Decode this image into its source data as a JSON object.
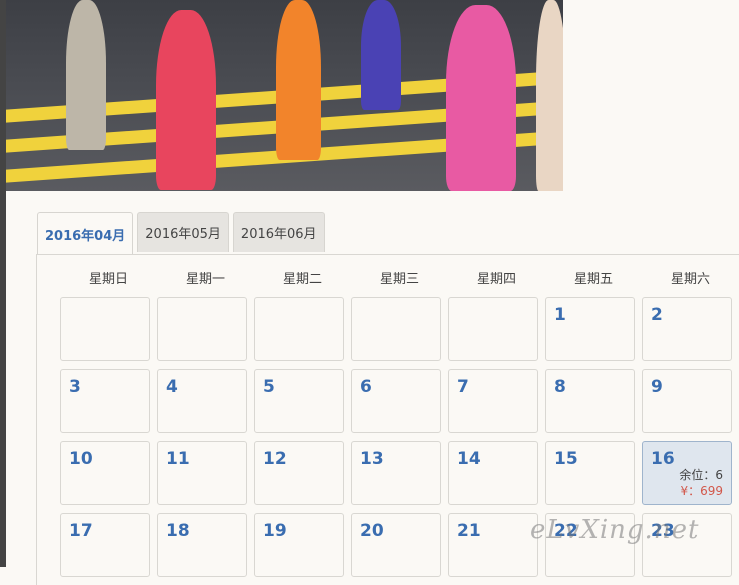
{
  "banner": {
    "carousel": {
      "count": 6,
      "active_index": 2
    }
  },
  "tabs": [
    {
      "label": "2016年04月",
      "active": true
    },
    {
      "label": "2016年05月",
      "active": false
    },
    {
      "label": "2016年06月",
      "active": false
    }
  ],
  "weekdays": [
    "星期日",
    "星期一",
    "星期二",
    "星期三",
    "星期四",
    "星期五",
    "星期六"
  ],
  "calendar": {
    "cells": [
      {
        "day": ""
      },
      {
        "day": ""
      },
      {
        "day": ""
      },
      {
        "day": ""
      },
      {
        "day": ""
      },
      {
        "day": "1"
      },
      {
        "day": "2"
      },
      {
        "day": "3"
      },
      {
        "day": "4"
      },
      {
        "day": "5"
      },
      {
        "day": "6"
      },
      {
        "day": "7"
      },
      {
        "day": "8"
      },
      {
        "day": "9"
      },
      {
        "day": "10"
      },
      {
        "day": "11"
      },
      {
        "day": "12"
      },
      {
        "day": "13"
      },
      {
        "day": "14"
      },
      {
        "day": "15"
      },
      {
        "day": "16",
        "seats": "余位：6",
        "price": "¥：699",
        "highlight": true
      },
      {
        "day": "17"
      },
      {
        "day": "18"
      },
      {
        "day": "19"
      },
      {
        "day": "20"
      },
      {
        "day": "21"
      },
      {
        "day": "22"
      },
      {
        "day": "23"
      }
    ]
  },
  "watermark": "eLvXing.net",
  "colors": {
    "accent": "#3a6db0",
    "price": "#d2574a",
    "highlight_bg": "#dfe6ee"
  }
}
